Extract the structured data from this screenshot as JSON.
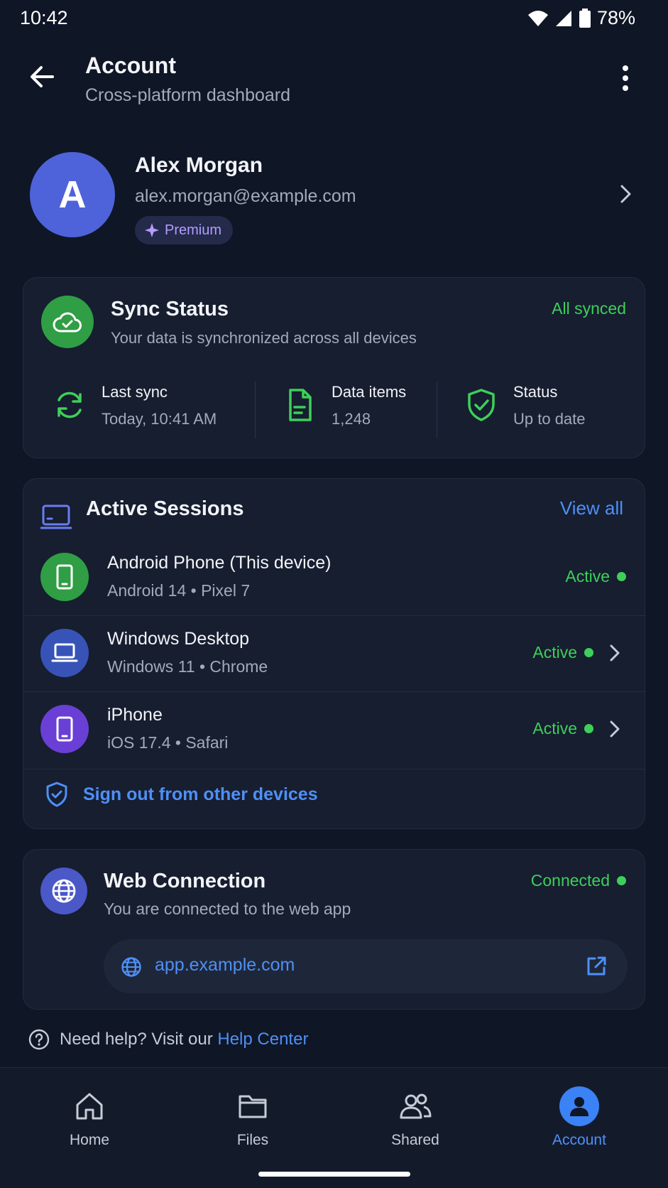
{
  "status_bar": {
    "time": "10:42",
    "battery": "78%"
  },
  "header": {
    "title": "Account",
    "subtitle": "Cross-platform dashboard"
  },
  "profile": {
    "initial": "A",
    "name": "Alex Morgan",
    "email": "alex.morgan@example.com",
    "badge": "Premium",
    "avatar_color": "#4e63d9"
  },
  "sync": {
    "title": "Sync Status",
    "subtitle": "Your data is synchronized across all devices",
    "status": "All synced",
    "stats": [
      {
        "label": "Last sync",
        "value": "Today, 10:41 AM"
      },
      {
        "label": "Data items",
        "value": "1,248"
      },
      {
        "label": "Status",
        "value": "Up to date"
      }
    ]
  },
  "sessions": {
    "title": "Active Sessions",
    "view_all": "View all",
    "items": [
      {
        "name": "Android Phone (This device)",
        "meta": "Android 14 • Pixel 7",
        "status": "Active",
        "icon": "phone-icon",
        "color": "#2f9e44"
      },
      {
        "name": "Windows Desktop",
        "meta": "Windows 11 • Chrome",
        "status": "Active",
        "icon": "laptop-icon",
        "color": "#3753b8"
      },
      {
        "name": "iPhone",
        "meta": "iOS 17.4 • Safari",
        "status": "Active",
        "icon": "phone-icon",
        "color": "#6a3fd6"
      }
    ],
    "sign_out": "Sign out from other devices"
  },
  "web": {
    "title": "Web Connection",
    "subtitle": "You are connected to the web app",
    "status": "Connected",
    "url": "app.example.com"
  },
  "help": {
    "text": "Need help? Visit our",
    "link": "Help Center"
  },
  "nav": {
    "items": [
      {
        "label": "Home",
        "icon": "home-icon"
      },
      {
        "label": "Files",
        "icon": "folder-icon"
      },
      {
        "label": "Shared",
        "icon": "people-icon"
      },
      {
        "label": "Account",
        "icon": "account-icon",
        "active": true
      }
    ]
  },
  "colors": {
    "accent": "#4f8ff7",
    "success": "#3ecf5a",
    "background": "#0f1626",
    "card": "#161e2f"
  }
}
